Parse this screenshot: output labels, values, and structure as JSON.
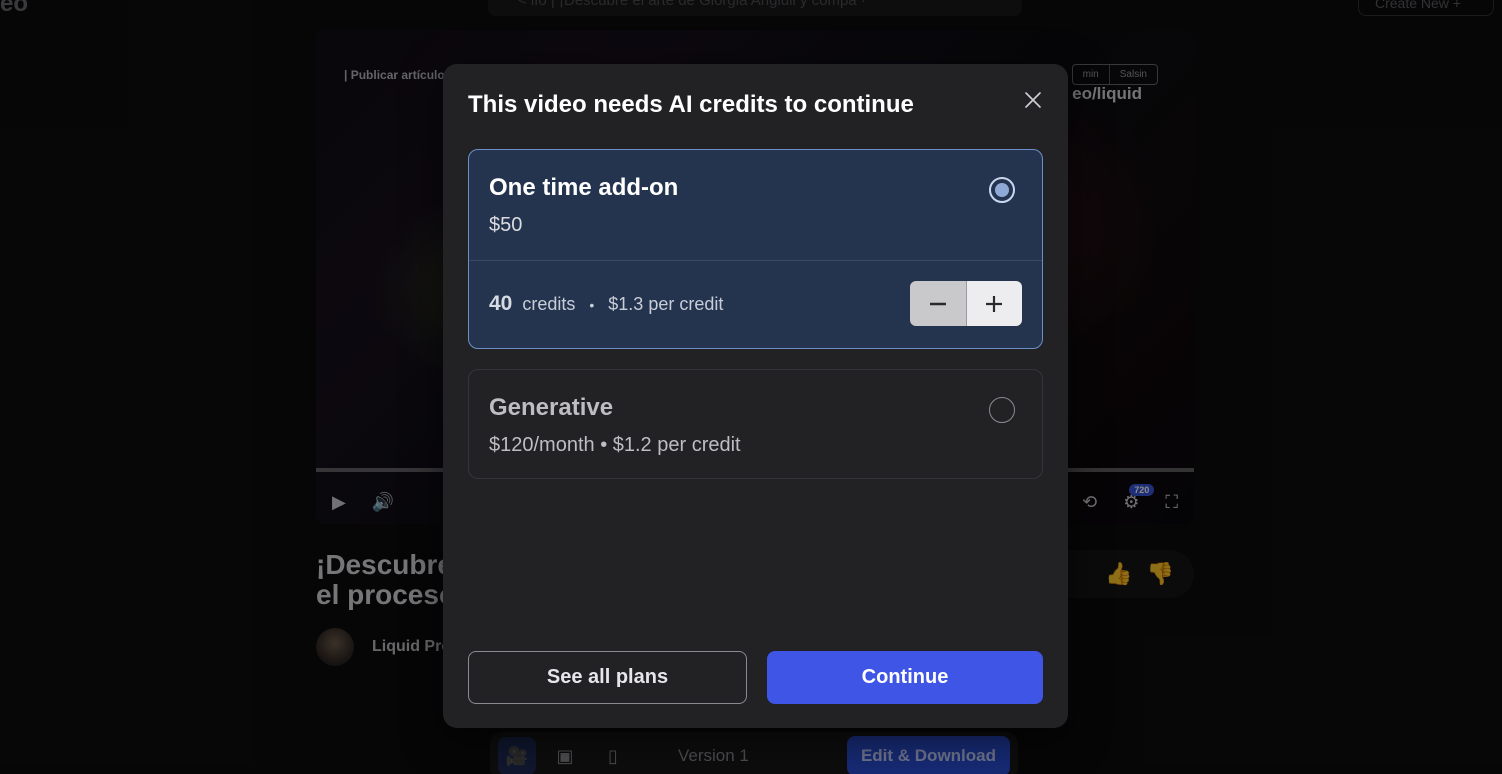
{
  "background": {
    "logo_partial": "eo",
    "breadcrumb": "< ifo  |  ¡Descubre el arte de Giorgia Angiuli y compa  ·",
    "create_new": "Create New  +",
    "player": {
      "overlay_left_label": "| Publicar artículo",
      "overlay_tags": [
        "min",
        "Salsin"
      ],
      "overlay_handle": "eo/liquid",
      "quality": "720",
      "icons": [
        "play-icon",
        "volume-icon",
        "loop-icon",
        "gear-icon",
        "fullscreen-icon"
      ]
    },
    "video_title": "¡Descubre el proceso!",
    "channel_name": "Liquid Pro",
    "toolbar": {
      "version_label": "Version 1",
      "edit_download_label": "Edit & Download"
    }
  },
  "modal": {
    "title": "This video needs AI credits to continue",
    "options": [
      {
        "name": "One time add-on",
        "price": "$50",
        "selected": true,
        "credits_count": "40",
        "credits_unit": "credits",
        "separator": "•",
        "per_credit": "$1.3 per credit"
      },
      {
        "name": "Generative",
        "price": "$120/month • $1.2 per credit",
        "selected": false
      }
    ],
    "buttons": {
      "see_all_plans": "See all plans",
      "continue": "Continue"
    },
    "colors": {
      "accent": "#3f55e6",
      "selected_card_bg": "#24344f",
      "selected_border": "#6c8fc6"
    }
  }
}
